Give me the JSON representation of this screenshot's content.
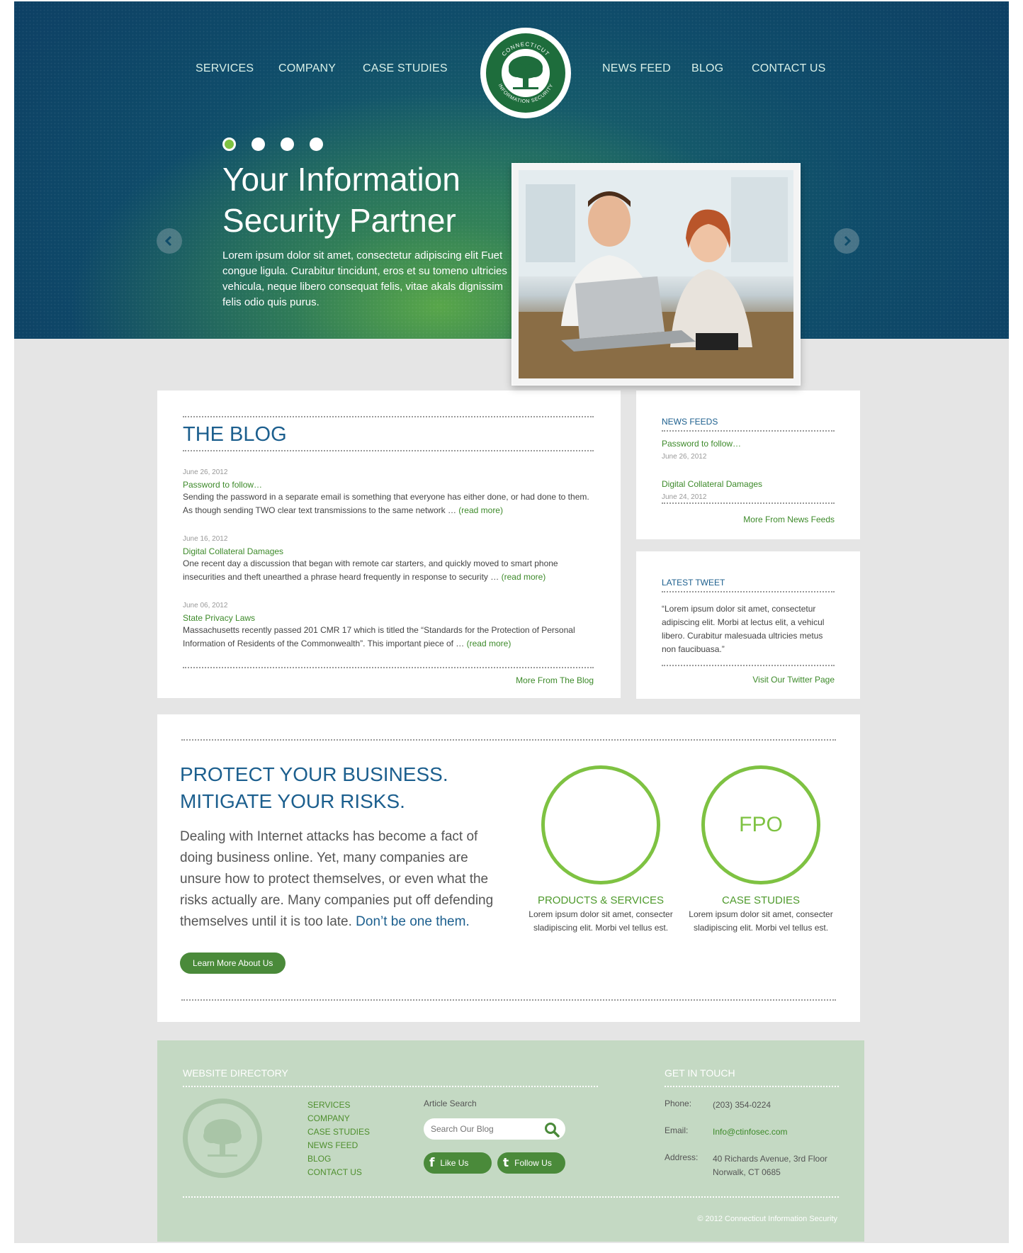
{
  "nav": {
    "left": [
      "SERVICES",
      "COMPANY",
      "CASE STUDIES"
    ],
    "right": [
      "NEWS FEED",
      "BLOG",
      "CONTACT US"
    ],
    "logo_text_top": "CONNECTICUT",
    "logo_text_bottom": "INFORMATION SECURITY"
  },
  "hero": {
    "title_line1": "Your Information",
    "title_line2": "Security Partner",
    "text": "Lorem ipsum dolor sit amet, consectetur adipiscing elit Fuet congue ligula. Curabitur tincidunt, eros et su tomeno ultricies vehicula, neque libero consequat felis, vitae akals dignissim felis odio quis purus.",
    "slide_count": 4,
    "active_slide": 1
  },
  "blog": {
    "title": "THE BLOG",
    "posts": [
      {
        "date": "June 26, 2012",
        "title": "Password to follow…",
        "excerpt": "Sending the password in a separate email is something that everyone has either done, or had done to them. As though sending TWO clear text transmissions to the same network …",
        "read_more": "(read more)"
      },
      {
        "date": "June 16, 2012",
        "title": "Digital Collateral Damages",
        "excerpt": "One recent day a discussion that began with remote car starters, and quickly moved to smart phone insecurities and theft unearthed a phrase heard frequently in response to security …",
        "read_more": "(read more)"
      },
      {
        "date": "June 06, 2012",
        "title": "State Privacy Laws",
        "excerpt": "Massachusetts recently passed 201 CMR 17 which is titled the “Standards for the Protection of Personal Information of Residents of the Commonwealth”. This important piece of …",
        "read_more": "(read more)"
      }
    ],
    "more": "More From The Blog"
  },
  "news_feeds": {
    "title": "NEWS FEEDS",
    "items": [
      {
        "title": "Password to follow…",
        "date": "June 26, 2012"
      },
      {
        "title": "Digital Collateral Damages",
        "date": "June 24, 2012"
      }
    ],
    "more": "More From News Feeds"
  },
  "tweet": {
    "title": "LATEST TWEET",
    "text": "“Lorem ipsum dolor sit amet, consectetur adipiscing elit. Morbi at lectus elit, a vehicul libero. Curabitur malesuada ultricies metus non faucibuasa.”",
    "more": "Visit Our Twitter Page"
  },
  "protect": {
    "title_line1": "PROTECT YOUR BUSINESS.",
    "title_line2": "MITIGATE YOUR RISKS.",
    "text": "Dealing with Internet attacks has become a fact of doing business online. Yet, many companies are unsure how to protect themselves, or even what the risks actually are. Many companies put off defending themselves until it is too late.",
    "text_highlight": "Don’t be one them.",
    "button": "Learn More About Us",
    "features": [
      {
        "circle_text": "",
        "title": "PRODUCTS & SERVICES",
        "text": "Lorem ipsum dolor sit amet, consecter sladipiscing elit. Morbi vel tellus est."
      },
      {
        "circle_text": "FPO",
        "title": "CASE STUDIES",
        "text": "Lorem ipsum dolor sit amet, consecter sladipiscing elit. Morbi vel tellus est."
      }
    ]
  },
  "footer": {
    "directory_title": "WEBSITE DIRECTORY",
    "links": [
      "SERVICES",
      "COMPANY",
      "CASE STUDIES",
      "NEWS FEED",
      "BLOG",
      "CONTACT US"
    ],
    "search_label": "Article Search",
    "search_placeholder": "Search Our Blog",
    "like": "Like Us",
    "follow": "Follow Us",
    "contact_title": "GET IN TOUCH",
    "phone_label": "Phone:",
    "phone": "(203) 354-0224",
    "email_label": "Email:",
    "email": "Info@ctinfosec.com",
    "address_label": "Address:",
    "address_line1": "40 Richards Avenue, 3rd Floor",
    "address_line2": "Norwalk, CT 0685",
    "copyright": "© 2012 Connecticut Information Security"
  },
  "colors": {
    "hero_blue": "#0d3f64",
    "hero_green": "#5caa48",
    "heading_blue": "#1c5f8e",
    "link_green": "#3d8a2a",
    "accent_green": "#7ec242",
    "footer_bg": "#c4d9c3"
  }
}
